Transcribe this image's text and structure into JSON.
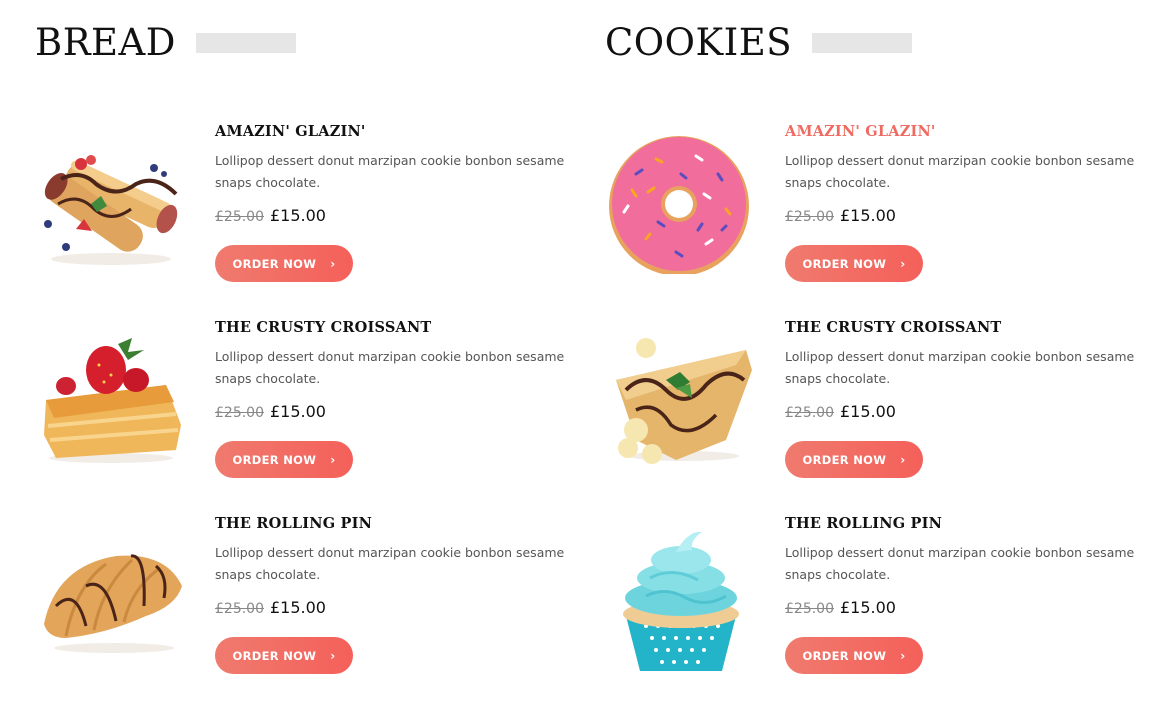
{
  "bread": {
    "title": "BREAD",
    "items": [
      {
        "name": "AMAZIN' GLAZIN'",
        "desc": "Lollipop dessert donut marzipan cookie bonbon sesame snaps chocolate.",
        "old_price": "£25.00",
        "price": "£15.00",
        "button": "ORDER NOW",
        "icon": "crepe-rolls"
      },
      {
        "name": "THE CRUSTY CROISSANT",
        "desc": "Lollipop dessert donut marzipan cookie bonbon sesame snaps chocolate.",
        "old_price": "£25.00",
        "price": "£15.00",
        "button": "ORDER NOW",
        "icon": "strawberry-pastry"
      },
      {
        "name": "THE ROLLING PIN",
        "desc": "Lollipop dessert donut marzipan cookie bonbon sesame snaps chocolate.",
        "old_price": "£25.00",
        "price": "£15.00",
        "button": "ORDER NOW",
        "icon": "croissant"
      }
    ]
  },
  "cookies": {
    "title": "COOKIES",
    "items": [
      {
        "name": "AMAZIN' GLAZIN'",
        "desc": "Lollipop dessert donut marzipan cookie bonbon sesame snaps chocolate.",
        "old_price": "£25.00",
        "price": "£15.00",
        "button": "ORDER NOW",
        "icon": "pink-donut"
      },
      {
        "name": "THE CRUSTY CROISSANT",
        "desc": "Lollipop dessert donut marzipan cookie bonbon sesame snaps chocolate.",
        "old_price": "£25.00",
        "price": "£15.00",
        "button": "ORDER NOW",
        "icon": "banana-crepe"
      },
      {
        "name": "THE ROLLING PIN",
        "desc": "Lollipop dessert donut marzipan cookie bonbon sesame snaps chocolate.",
        "old_price": "£25.00",
        "price": "£15.00",
        "button": "ORDER NOW",
        "icon": "cupcake"
      }
    ]
  },
  "colors": {
    "accent": "#ef6a61",
    "button_start": "#f07a6e",
    "button_end": "#f4605a",
    "placeholder_bar": "#e6e6e6"
  }
}
